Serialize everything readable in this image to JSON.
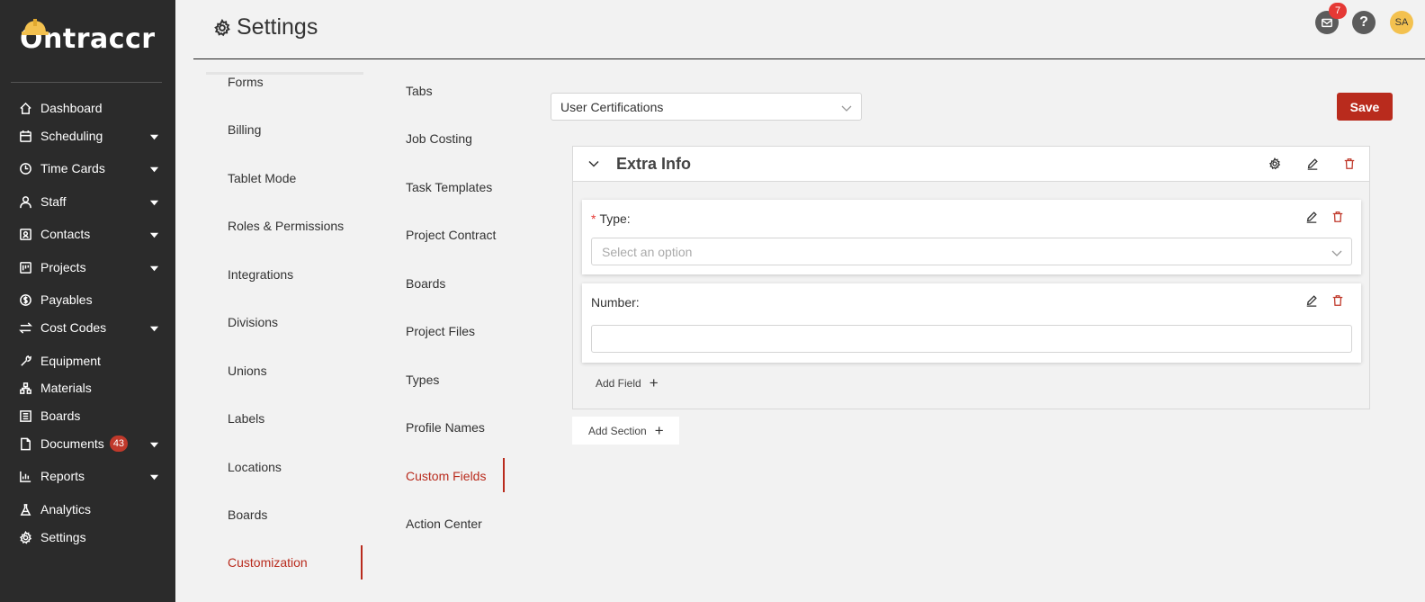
{
  "app": {
    "logo_text": "Ontraccr"
  },
  "sidebar": {
    "items": [
      {
        "label": "Dashboard",
        "icon": "home-icon",
        "has_chevron": false
      },
      {
        "label": "Scheduling",
        "icon": "calendar-icon",
        "has_chevron": true
      },
      {
        "label": "Time Cards",
        "icon": "clock-icon",
        "has_chevron": true
      },
      {
        "label": "Staff",
        "icon": "user-icon",
        "has_chevron": true
      },
      {
        "label": "Contacts",
        "icon": "contacts-icon",
        "has_chevron": true
      },
      {
        "label": "Projects",
        "icon": "projects-icon",
        "has_chevron": true
      },
      {
        "label": "Payables",
        "icon": "dollar-icon",
        "has_chevron": false
      },
      {
        "label": "Cost Codes",
        "icon": "swap-icon",
        "has_chevron": true
      },
      {
        "label": "Equipment",
        "icon": "wrench-icon",
        "has_chevron": false
      },
      {
        "label": "Materials",
        "icon": "materials-icon",
        "has_chevron": false
      },
      {
        "label": "Boards",
        "icon": "board-icon",
        "has_chevron": false
      },
      {
        "label": "Documents",
        "icon": "file-icon",
        "has_chevron": true,
        "badge": "43"
      },
      {
        "label": "Reports",
        "icon": "chart-icon",
        "has_chevron": true
      },
      {
        "label": "Analytics",
        "icon": "flask-icon",
        "has_chevron": false
      },
      {
        "label": "Settings",
        "icon": "gear-icon",
        "has_chevron": false
      }
    ]
  },
  "header": {
    "title": "Settings",
    "mail_badge": "7",
    "help_label": "?",
    "avatar_initials": "SA"
  },
  "settings_menu": {
    "items": [
      "Forms",
      "Billing",
      "Tablet Mode",
      "Roles & Permissions",
      "Integrations",
      "Divisions",
      "Unions",
      "Labels",
      "Locations",
      "Boards",
      "Customization"
    ],
    "active": "Customization"
  },
  "customization_menu": {
    "items": [
      "Tabs",
      "Job Costing",
      "Task Templates",
      "Project Contract",
      "Boards",
      "Project Files",
      "Types",
      "Profile Names",
      "Custom Fields",
      "Action Center"
    ],
    "active": "Custom Fields"
  },
  "main": {
    "selected_entity": "User Certifications",
    "save_label": "Save",
    "section": {
      "title": "Extra Info",
      "fields": [
        {
          "label": "Type:",
          "required": true,
          "kind": "select",
          "placeholder": "Select an option"
        },
        {
          "label": "Number:",
          "required": false,
          "kind": "text",
          "value": ""
        }
      ],
      "add_field_label": "Add Field"
    },
    "add_section_label": "Add Section"
  },
  "colors": {
    "accent": "#b92b1d",
    "sidebar_bg": "#2b2b2b",
    "badge_red": "#e53935"
  }
}
